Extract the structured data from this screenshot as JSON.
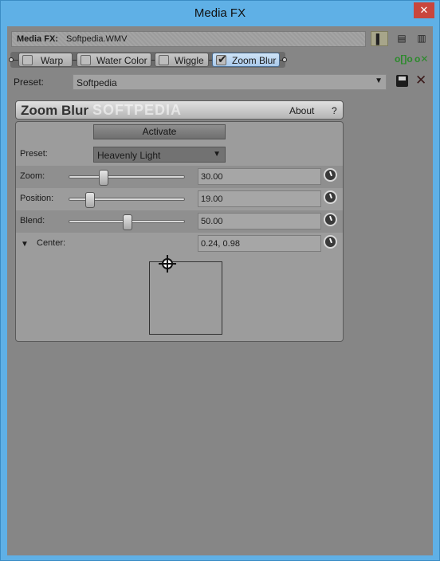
{
  "window": {
    "title": "Media FX",
    "close_label": "✕"
  },
  "fxbar": {
    "label": "Media FX:",
    "value": "Softpedia.WMV"
  },
  "view_buttons": [
    "▌",
    "▤",
    "▥"
  ],
  "chain": [
    {
      "label": "Warp",
      "checked": false
    },
    {
      "label": "Water Color",
      "checked": false
    },
    {
      "label": "Wiggle",
      "checked": false
    },
    {
      "label": "Zoom Blur",
      "checked": true
    }
  ],
  "chain_icons": [
    "plug-in-chain-icon",
    "remove-plug-in-icon"
  ],
  "preset_row": {
    "label": "Preset:",
    "value": "Softpedia"
  },
  "plugin": {
    "name": "Zoom Blur",
    "watermark": "SOFTPEDIA",
    "about": "About",
    "help": "?",
    "activate": "Activate",
    "preset_label": "Preset:",
    "preset_value": "Heavenly Light",
    "zoom": {
      "label": "Zoom:",
      "value": "30.00",
      "level": 0.3
    },
    "position": {
      "label": "Position:",
      "value": "19.00",
      "level": 0.19
    },
    "blend": {
      "label": "Blend:",
      "value": "50.00",
      "level": 0.5
    },
    "center": {
      "label": "Center:",
      "value": "0.24, 0.98"
    }
  },
  "colors": {
    "title_bar": "#5fb0e6",
    "selected_pill": "#a9c9ea",
    "close": "#c9463d"
  }
}
